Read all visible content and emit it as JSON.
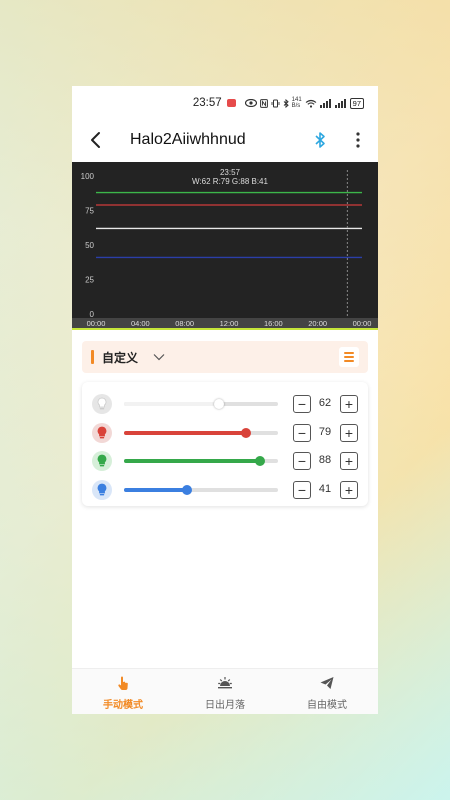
{
  "status_bar": {
    "time": "23:57",
    "net_speed_top": "141",
    "net_speed_unit": "B/s",
    "battery": "97"
  },
  "app_bar": {
    "title": "Halo2Aiiwhhnud"
  },
  "chart_data": {
    "type": "line",
    "header_time": "23:57",
    "header_values": "W:62 R:79 G:88 B:41",
    "y_ticks": [
      "100",
      "75",
      "50",
      "25",
      "0"
    ],
    "x_ticks": [
      "00:00",
      "04:00",
      "08:00",
      "12:00",
      "16:00",
      "20:00",
      "00:00"
    ],
    "ylim": [
      0,
      100
    ],
    "series": [
      {
        "color": "#3cb64a",
        "values": [
          88,
          88
        ]
      },
      {
        "color": "#d23c3c",
        "values": [
          79,
          79
        ]
      },
      {
        "color": "#e8e8e8",
        "values": [
          62,
          62
        ]
      },
      {
        "color": "#2b3ea8",
        "values": [
          41,
          41
        ]
      }
    ],
    "cursor_fraction": 0.945
  },
  "mode": {
    "label": "自定义"
  },
  "channels": [
    {
      "value": "62",
      "level": 62,
      "color": "#f2f2f2",
      "thumb": "#ffffff",
      "icon_bg": "#e6e6e6",
      "icon_fg": "#ffffff"
    },
    {
      "value": "79",
      "level": 79,
      "color": "#d9433a",
      "thumb": "#d9433a",
      "icon_bg": "#f2d8d6",
      "icon_fg": "#d9433a"
    },
    {
      "value": "88",
      "level": 88,
      "color": "#35a84a",
      "thumb": "#35a84a",
      "icon_bg": "#d6efd9",
      "icon_fg": "#35a84a"
    },
    {
      "value": "41",
      "level": 41,
      "color": "#3b7fe0",
      "thumb": "#3b7fe0",
      "icon_bg": "#d9e6f8",
      "icon_fg": "#3b7fe0"
    }
  ],
  "controls": {
    "minus": "−",
    "plus": "+"
  },
  "bottom_nav": {
    "tabs": [
      {
        "label": "手动模式",
        "icon": "hand-pointer-icon",
        "active": true
      },
      {
        "label": "日出月落",
        "icon": "sunrise-icon",
        "active": false
      },
      {
        "label": "自由模式",
        "icon": "paper-plane-icon",
        "active": false
      }
    ]
  },
  "colors": {
    "accent": "#f28a25",
    "bluetooth": "#2ea7e0"
  }
}
